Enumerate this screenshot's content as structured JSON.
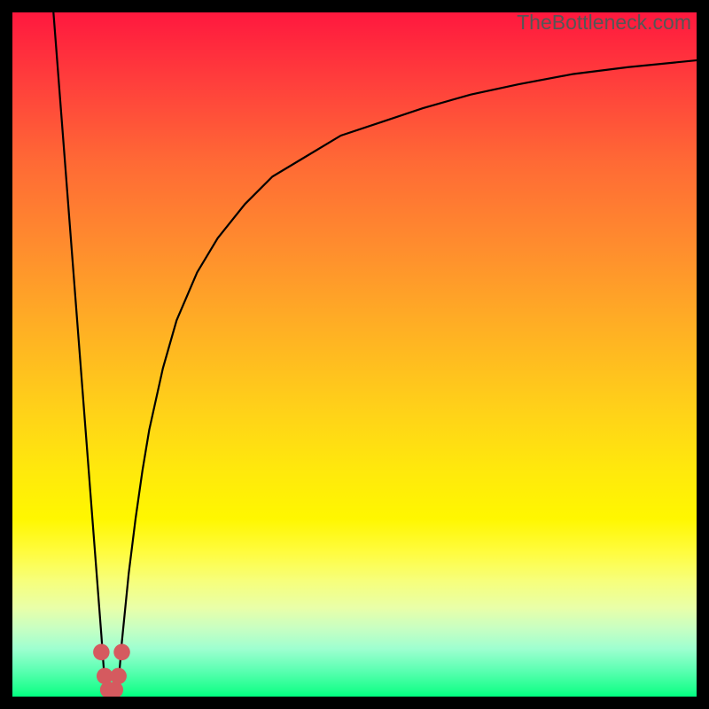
{
  "watermark": "TheBottleneck.com",
  "chart_data": {
    "type": "line",
    "title": "",
    "xlabel": "",
    "ylabel": "",
    "xlim": [
      0,
      100
    ],
    "ylim": [
      0,
      100
    ],
    "grid": false,
    "legend": false,
    "colors": {
      "top": "#ff183e",
      "mid": "#ffe000",
      "bottom": "#00ff80",
      "curve": "#000000",
      "marker": "#d55a5f"
    },
    "series": [
      {
        "name": "left-branch",
        "x": [
          6,
          7,
          8,
          9,
          10,
          11,
          12,
          13,
          13.5
        ],
        "y": [
          100,
          87,
          74,
          61,
          48,
          35,
          22,
          9,
          2
        ]
      },
      {
        "name": "right-branch",
        "x": [
          15.5,
          16,
          17,
          18,
          19,
          20,
          22,
          24,
          27,
          30,
          34,
          38,
          43,
          48,
          54,
          60,
          67,
          74,
          82,
          90,
          100
        ],
        "y": [
          2,
          8,
          18,
          26,
          33,
          39,
          48,
          55,
          62,
          67,
          72,
          76,
          79,
          82,
          84,
          86,
          88,
          89.5,
          91,
          92,
          93
        ]
      }
    ],
    "markers": [
      {
        "x": 13.0,
        "y": 6.5,
        "r": 1.2
      },
      {
        "x": 13.5,
        "y": 3.0,
        "r": 1.2
      },
      {
        "x": 14.0,
        "y": 1.0,
        "r": 1.2
      },
      {
        "x": 14.5,
        "y": 0.0,
        "r": 1.2
      },
      {
        "x": 15.0,
        "y": 1.0,
        "r": 1.2
      },
      {
        "x": 15.5,
        "y": 3.0,
        "r": 1.2
      },
      {
        "x": 16.0,
        "y": 6.5,
        "r": 1.2
      }
    ],
    "notch_x": 14.5
  }
}
